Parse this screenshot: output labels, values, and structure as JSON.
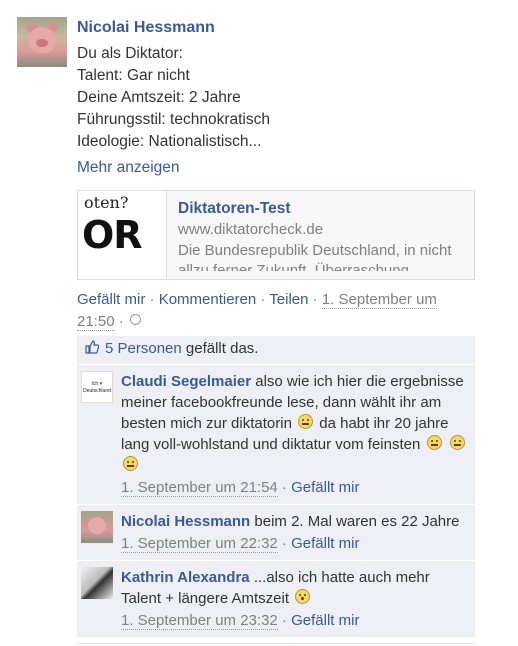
{
  "post": {
    "author": "Nicolai Hessmann",
    "message_lines": [
      "Du als Diktator:",
      "Talent: Gar nicht",
      "Deine Amtszeit: 2 Jahre",
      "Führungsstil: technokratisch",
      "Ideologie: Nationalistisch..."
    ],
    "more_link": "Mehr anzeigen",
    "attachment": {
      "title": "Diktatoren-Test",
      "url": "www.diktatorcheck.de",
      "description": "Die Bundesrepublik Deutschland, in nicht allzu ferner Zukunft. Überraschung",
      "thumb_small_text": "oten?",
      "thumb_big_text": "OR"
    },
    "actions": {
      "like": "Gefällt mir",
      "comment": "Kommentieren",
      "share": "Teilen",
      "timestamp": "1. September um 21:50",
      "sep": " · "
    }
  },
  "likes": {
    "count_link": "5 Personen",
    "suffix": " gefällt das."
  },
  "comments": [
    {
      "author": "Claudi Segelmaier",
      "text_a": " also wie ich hier die ergebnisse meiner facebookfreunde lese, dann wählt ihr am besten mich zur diktatorin ",
      "text_b": " da habt ihr 20 jahre lang voll-wohlstand und diktatur vom feinsten ",
      "timestamp": "1. September um 21:54",
      "like": "Gefällt mir",
      "avatar_text_1": "Ich",
      "avatar_heart": "♥",
      "avatar_text_2": "Deutschland"
    },
    {
      "author": "Nicolai Hessmann",
      "text": " beim 2. Mal waren es 22 Jahre",
      "timestamp": "1. September um 22:32",
      "like": "Gefällt mir"
    },
    {
      "author": "Kathrin Alexandra",
      "text": " ...also ich hatte auch mehr Talent + längere Amtszeit ",
      "timestamp": "1. September um 23:32",
      "like": "Gefällt mir"
    }
  ],
  "icons": {
    "like_thumb": "thumbs-up-icon",
    "smiley": "smiley-icon",
    "globe": "globe-icon"
  },
  "colors": {
    "link": "#3b5998",
    "ufi_bg": "#edeff4",
    "meta_gray": "#808080"
  }
}
